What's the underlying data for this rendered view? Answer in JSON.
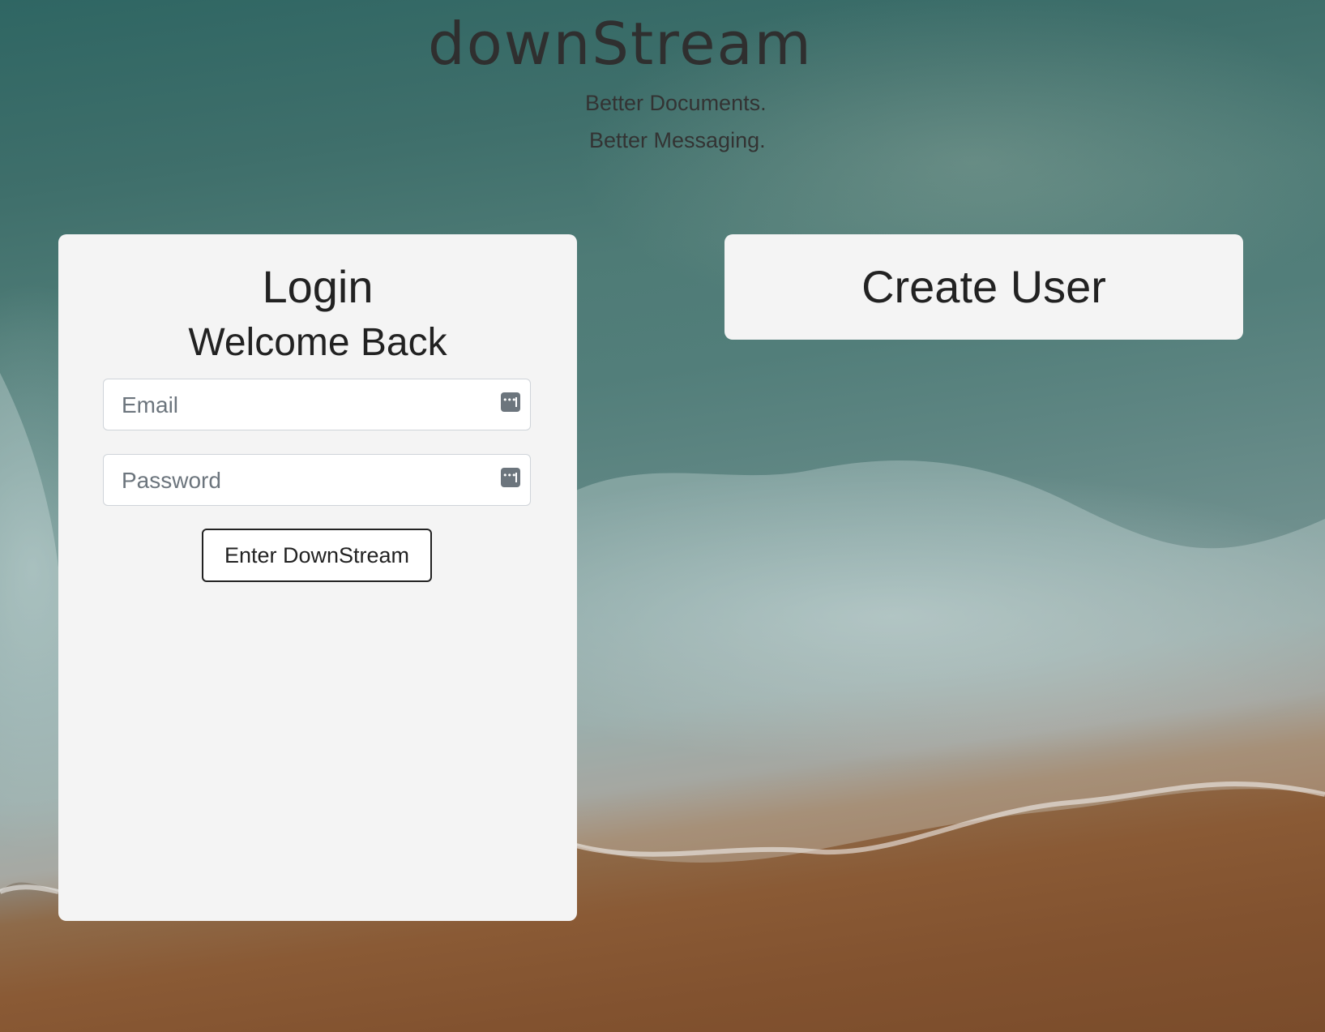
{
  "header": {
    "app_title": "downStream",
    "tagline_1": "Better Documents.",
    "tagline_2": "Better Messaging."
  },
  "login": {
    "title": "Login",
    "subtitle": "Welcome Back",
    "email": {
      "placeholder": "Email",
      "value": "",
      "icon": "key-icon"
    },
    "password": {
      "placeholder": "Password",
      "value": "",
      "icon": "key-icon"
    },
    "submit_label": "Enter DownStream"
  },
  "create_user": {
    "title": "Create User"
  },
  "colors": {
    "panel_bg": "#f4f4f4",
    "text": "#222222",
    "ocean": "#3f6f6b",
    "sand": "#82522f"
  }
}
